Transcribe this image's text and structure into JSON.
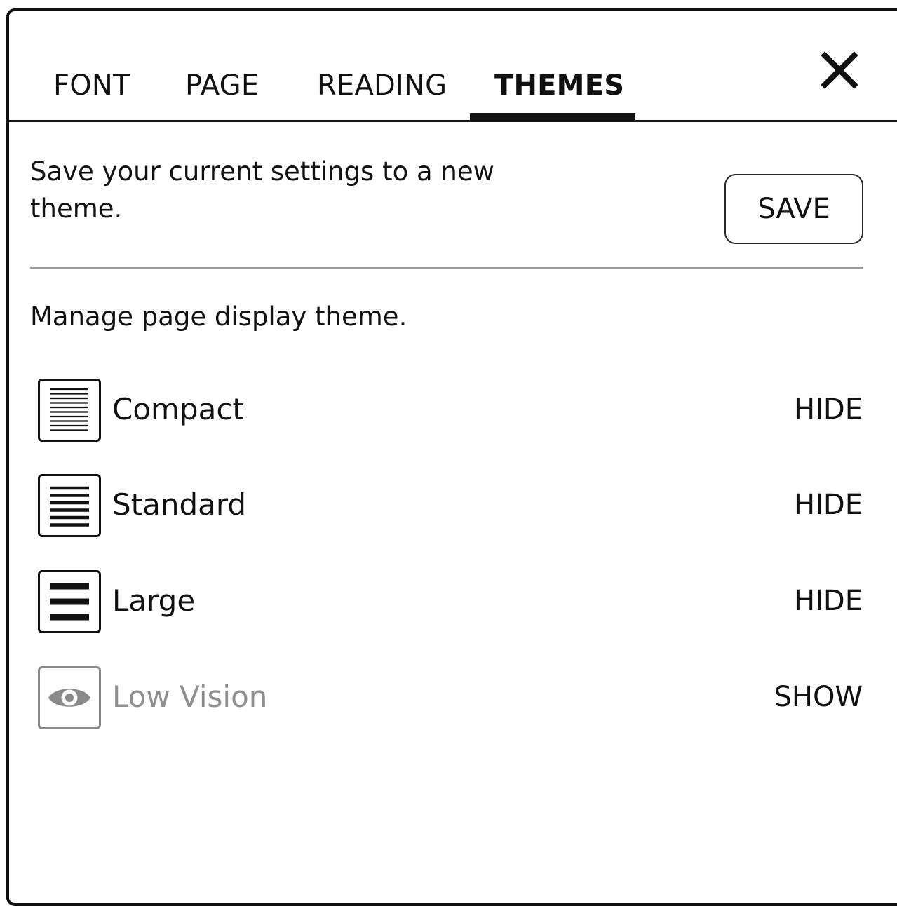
{
  "tabs": [
    {
      "label": "FONT",
      "active": false
    },
    {
      "label": "PAGE",
      "active": false
    },
    {
      "label": "READING",
      "active": false
    },
    {
      "label": "THEMES",
      "active": true
    }
  ],
  "close_icon": "close-icon",
  "save_section": {
    "description": "Save your current settings to a new theme.",
    "button_label": "SAVE"
  },
  "manage_section": {
    "description": "Manage page display theme."
  },
  "themes": [
    {
      "name": "Compact",
      "icon": "compact-lines-icon",
      "action": "HIDE",
      "hidden": false
    },
    {
      "name": "Standard",
      "icon": "standard-lines-icon",
      "action": "HIDE",
      "hidden": false
    },
    {
      "name": "Large",
      "icon": "large-lines-icon",
      "action": "HIDE",
      "hidden": false
    },
    {
      "name": "Low Vision",
      "icon": "eye-icon",
      "action": "SHOW",
      "hidden": true
    }
  ],
  "colors": {
    "text": "#111111",
    "dimmed": "#8e8e8e",
    "divider": "#9c9c9c"
  }
}
